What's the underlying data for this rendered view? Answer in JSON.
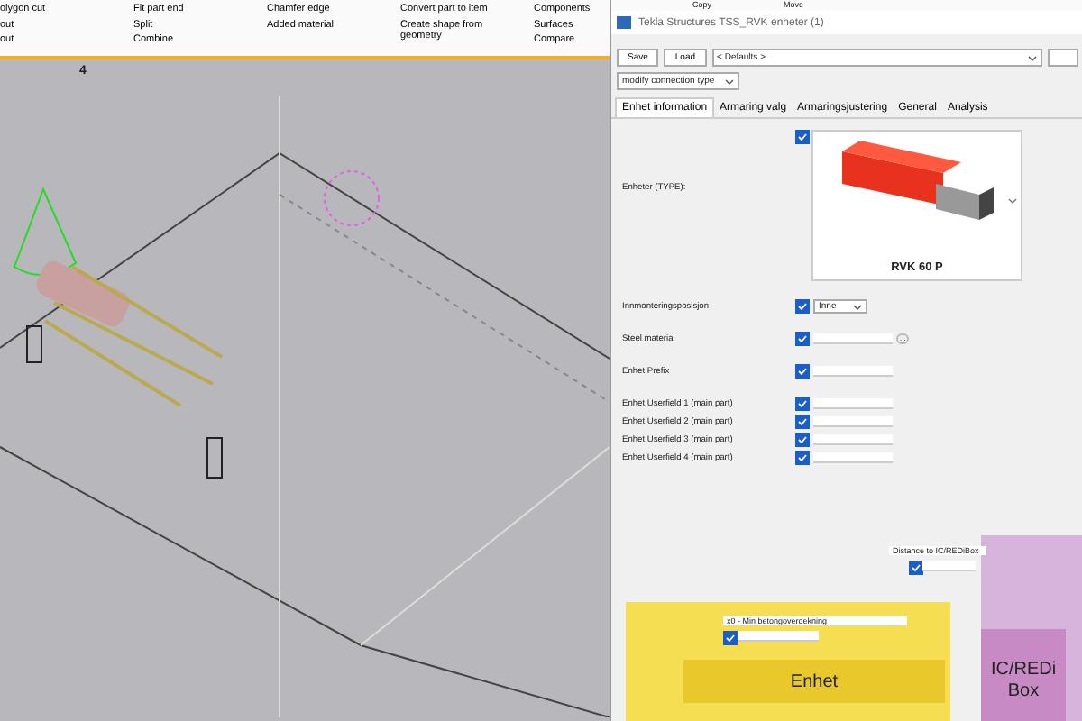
{
  "ribbon": {
    "groups": [
      {
        "items": [
          "olygon cut",
          "out",
          "out"
        ]
      },
      {
        "items": [
          "Fit part end",
          "Split",
          "Combine"
        ]
      },
      {
        "items": [
          "Chamfer edge",
          "Added material"
        ]
      },
      {
        "items": [
          "Convert part to item",
          "Create shape from geometry"
        ]
      },
      {
        "items": [
          "Components",
          "Surfaces",
          "Compare"
        ]
      }
    ],
    "top_items": [
      "Copy",
      "Move"
    ]
  },
  "viewport": {
    "label": "4"
  },
  "dialog": {
    "title": "Tekla Structures  TSS_RVK enheter (1)",
    "save": "Save",
    "load": "Load",
    "preset": "< Defaults >",
    "connection_type": "modify connection type",
    "tabs": [
      {
        "label": "Enhet information",
        "selected": true
      },
      {
        "label": "Armaring valg",
        "selected": false
      },
      {
        "label": "Armaringsjustering",
        "selected": false
      },
      {
        "label": "General",
        "selected": false
      },
      {
        "label": "Analysis",
        "selected": false
      }
    ],
    "type_row": {
      "label": "Enheter (TYPE):",
      "checked": true,
      "image_caption": "RVK 60 P"
    },
    "fields": [
      {
        "kind": "select",
        "label": "Innmonteringsposisjon",
        "checked": true,
        "value": "Inne"
      },
      {
        "kind": "browse",
        "label": "Steel material",
        "checked": true,
        "button": "..."
      },
      {
        "kind": "text",
        "label": "Enhet Prefix",
        "checked": true
      },
      {
        "kind": "text",
        "label": "Enhet Userfield 1 (main part)",
        "checked": true
      },
      {
        "kind": "text",
        "label": "Enhet Userfield 2 (main part)",
        "checked": true
      },
      {
        "kind": "text",
        "label": "Enhet Userfield 3 (main part)",
        "checked": true
      },
      {
        "kind": "text",
        "label": "Enhet Userfield 4 (main part)",
        "checked": true
      }
    ],
    "diagram": {
      "distance_label": "Distance to IC/REDiBox",
      "distance_checked": true,
      "cover_label": "x0 - Min betongoverdekning",
      "cover_checked": true,
      "unit_label": "Enhet",
      "box_label": "IC/REDi Box"
    }
  }
}
